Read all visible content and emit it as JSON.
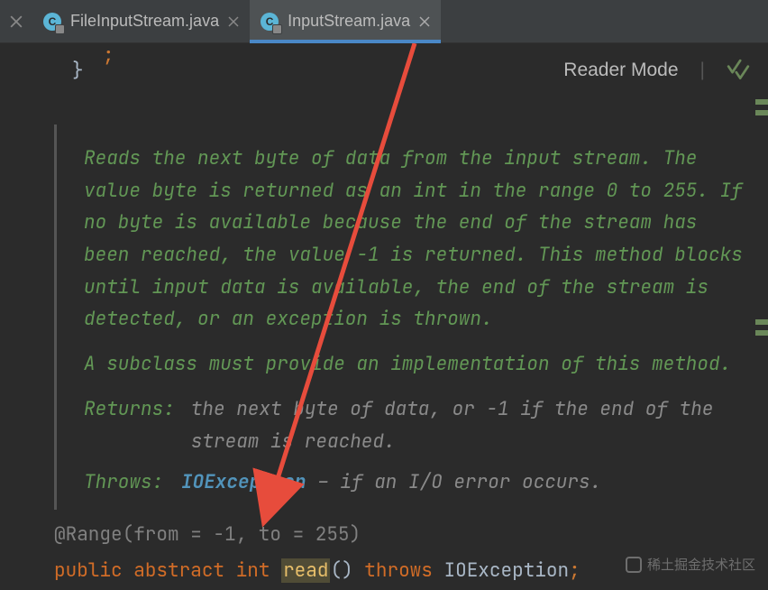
{
  "tabs": [
    {
      "label": "FileInputStream.java",
      "icon_letter": "C"
    },
    {
      "label": "InputStream.java",
      "icon_letter": "C"
    }
  ],
  "tab_left_close": "×",
  "toolbar": {
    "brace": "}",
    "reader_mode": "Reader Mode"
  },
  "top_punct": ";",
  "doc": {
    "body1": "Reads the next byte of data from the input stream. The value byte is returned as an int in the range 0 to 255. If no byte is available because the end of the stream has been reached, the value -1 is returned. This method blocks until input data is available, the end of the stream is detected, or an exception is thrown.",
    "body2": "A subclass must provide an implementation of this method.",
    "returns_label": "Returns:",
    "returns_value": "the next byte of data, or -1 if the end of the stream is reached.",
    "throws_label": "Throws:",
    "throws_exc": "IOException",
    "throws_rest": " – if an I/O error occurs."
  },
  "annotation": "@Range(from = -1, to = 255)",
  "code": {
    "public": "public",
    "abstract": "abstract",
    "int": "int",
    "method": "read",
    "parens": "()",
    "throws": "throws",
    "exc": "IOException",
    "semi": ";"
  },
  "watermark": "稀土掘金技术社区"
}
